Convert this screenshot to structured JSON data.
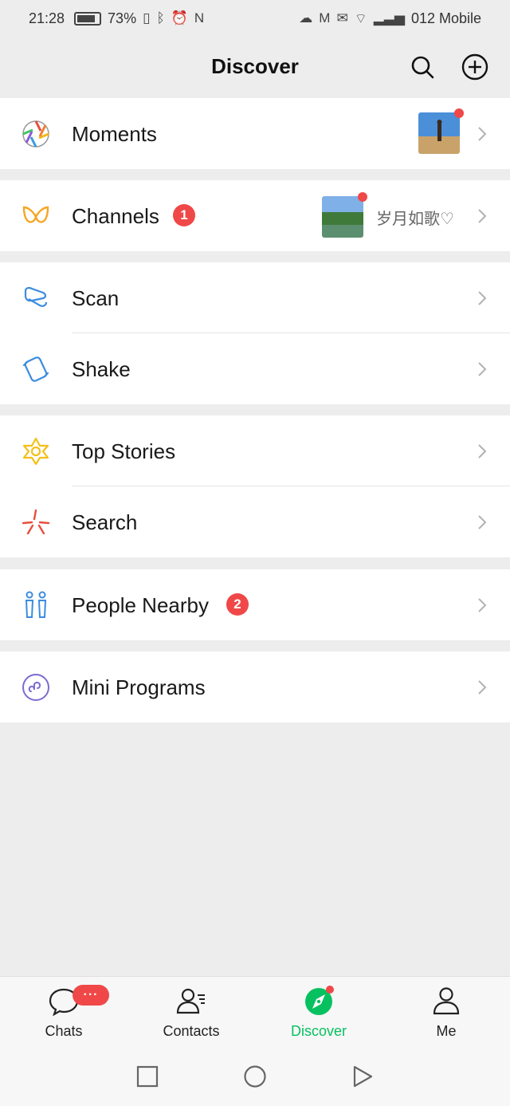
{
  "status_bar": {
    "time": "21:28",
    "battery": "73%",
    "carrier": "012 Mobile"
  },
  "header": {
    "title": "Discover",
    "search_icon": "search-icon",
    "add_icon": "add-circle-icon"
  },
  "cells": {
    "moments": {
      "label": "Moments",
      "icon": "moments-icon"
    },
    "channels": {
      "label": "Channels",
      "badge": "1",
      "channel_name": "岁月如歌♡",
      "icon": "channels-icon"
    },
    "scan": {
      "label": "Scan",
      "icon": "scan-icon"
    },
    "shake": {
      "label": "Shake",
      "icon": "shake-icon"
    },
    "top_stories": {
      "label": "Top Stories",
      "icon": "top-stories-icon"
    },
    "search": {
      "label": "Search",
      "icon": "search-feature-icon"
    },
    "people_nearby": {
      "label": "People Nearby",
      "badge": "2",
      "icon": "people-nearby-icon"
    },
    "mini_programs": {
      "label": "Mini Programs",
      "icon": "mini-programs-icon"
    }
  },
  "tabbar": {
    "chats": {
      "label": "Chats",
      "badge": "···"
    },
    "contacts": {
      "label": "Contacts"
    },
    "discover": {
      "label": "Discover"
    },
    "me": {
      "label": "Me"
    }
  },
  "colors": {
    "accent": "#07c160",
    "badge": "#f04848",
    "background": "#ededed"
  }
}
